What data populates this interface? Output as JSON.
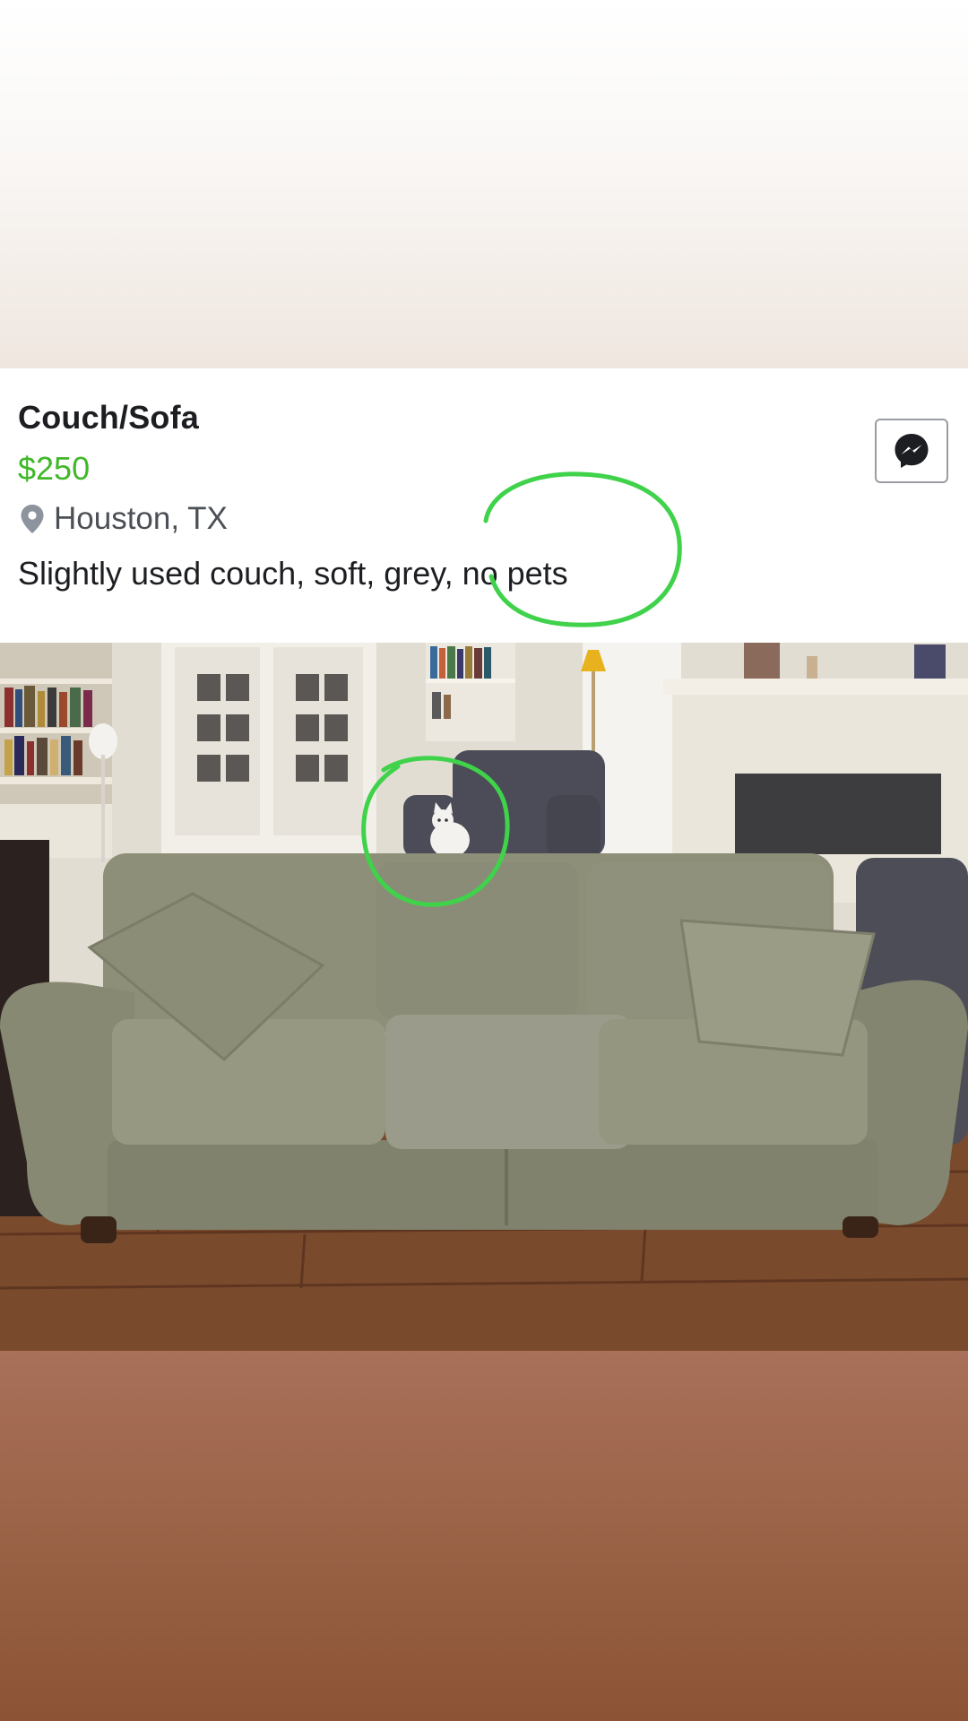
{
  "listing": {
    "title": "Couch/Sofa",
    "price": "$250",
    "location": "Houston, TX",
    "description": "Slightly used couch, soft, grey, no pets"
  },
  "icons": {
    "location": "map-pin-icon",
    "message": "messenger-icon"
  },
  "annotations": {
    "color": "#3fd24a",
    "circled_text": "no pets",
    "circled_photo_subject": "white cat"
  },
  "colors": {
    "price": "#42b72a",
    "title": "#1c1e21",
    "secondary_text": "#4b4f56"
  }
}
